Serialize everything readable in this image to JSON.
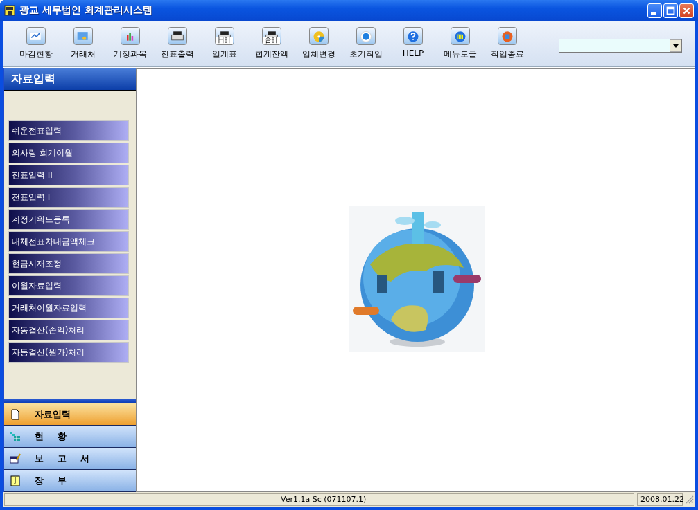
{
  "window": {
    "title": "광교 세무법인 회계관리시스템"
  },
  "toolbar": [
    {
      "label": "마감현황",
      "kind": "chart"
    },
    {
      "label": "거래처",
      "kind": "screen"
    },
    {
      "label": "계정과목",
      "kind": "bars"
    },
    {
      "label": "전표출력",
      "kind": "printer"
    },
    {
      "label": "일계표",
      "kind": "printer",
      "icon_text": "日計"
    },
    {
      "label": "합계잔액",
      "kind": "printer",
      "icon_text": "合計"
    },
    {
      "label": "업체변경",
      "kind": "disc"
    },
    {
      "label": "초기작업",
      "kind": "ring"
    },
    {
      "label": "HELP",
      "kind": "help"
    },
    {
      "label": "메뉴토글",
      "kind": "menu"
    },
    {
      "label": "작업종료",
      "kind": "exit"
    }
  ],
  "sidebar": {
    "title": "자료입력",
    "items": [
      "쉬운전표입력",
      "의사랑 회계이월",
      "전표입력 II",
      "전표입력 I",
      "계정키워드등록",
      "대체전표차대금액체크",
      "현금시재조정",
      "이월자료입력",
      "거래처이월자료입력",
      "자동결산(손익)처리",
      "자동결산(원가)처리"
    ],
    "sections": [
      {
        "label": "자료입력",
        "selected": true,
        "kind": "page"
      },
      {
        "label": "현 황",
        "selected": false,
        "kind": "grid"
      },
      {
        "label": "보 고 서",
        "selected": false,
        "kind": "calendar"
      },
      {
        "label": "장 부",
        "selected": false,
        "kind": "book"
      }
    ]
  },
  "status_bar": {
    "version": "Ver1.1a Sc (071107.1)",
    "date": "2008.01.22"
  }
}
